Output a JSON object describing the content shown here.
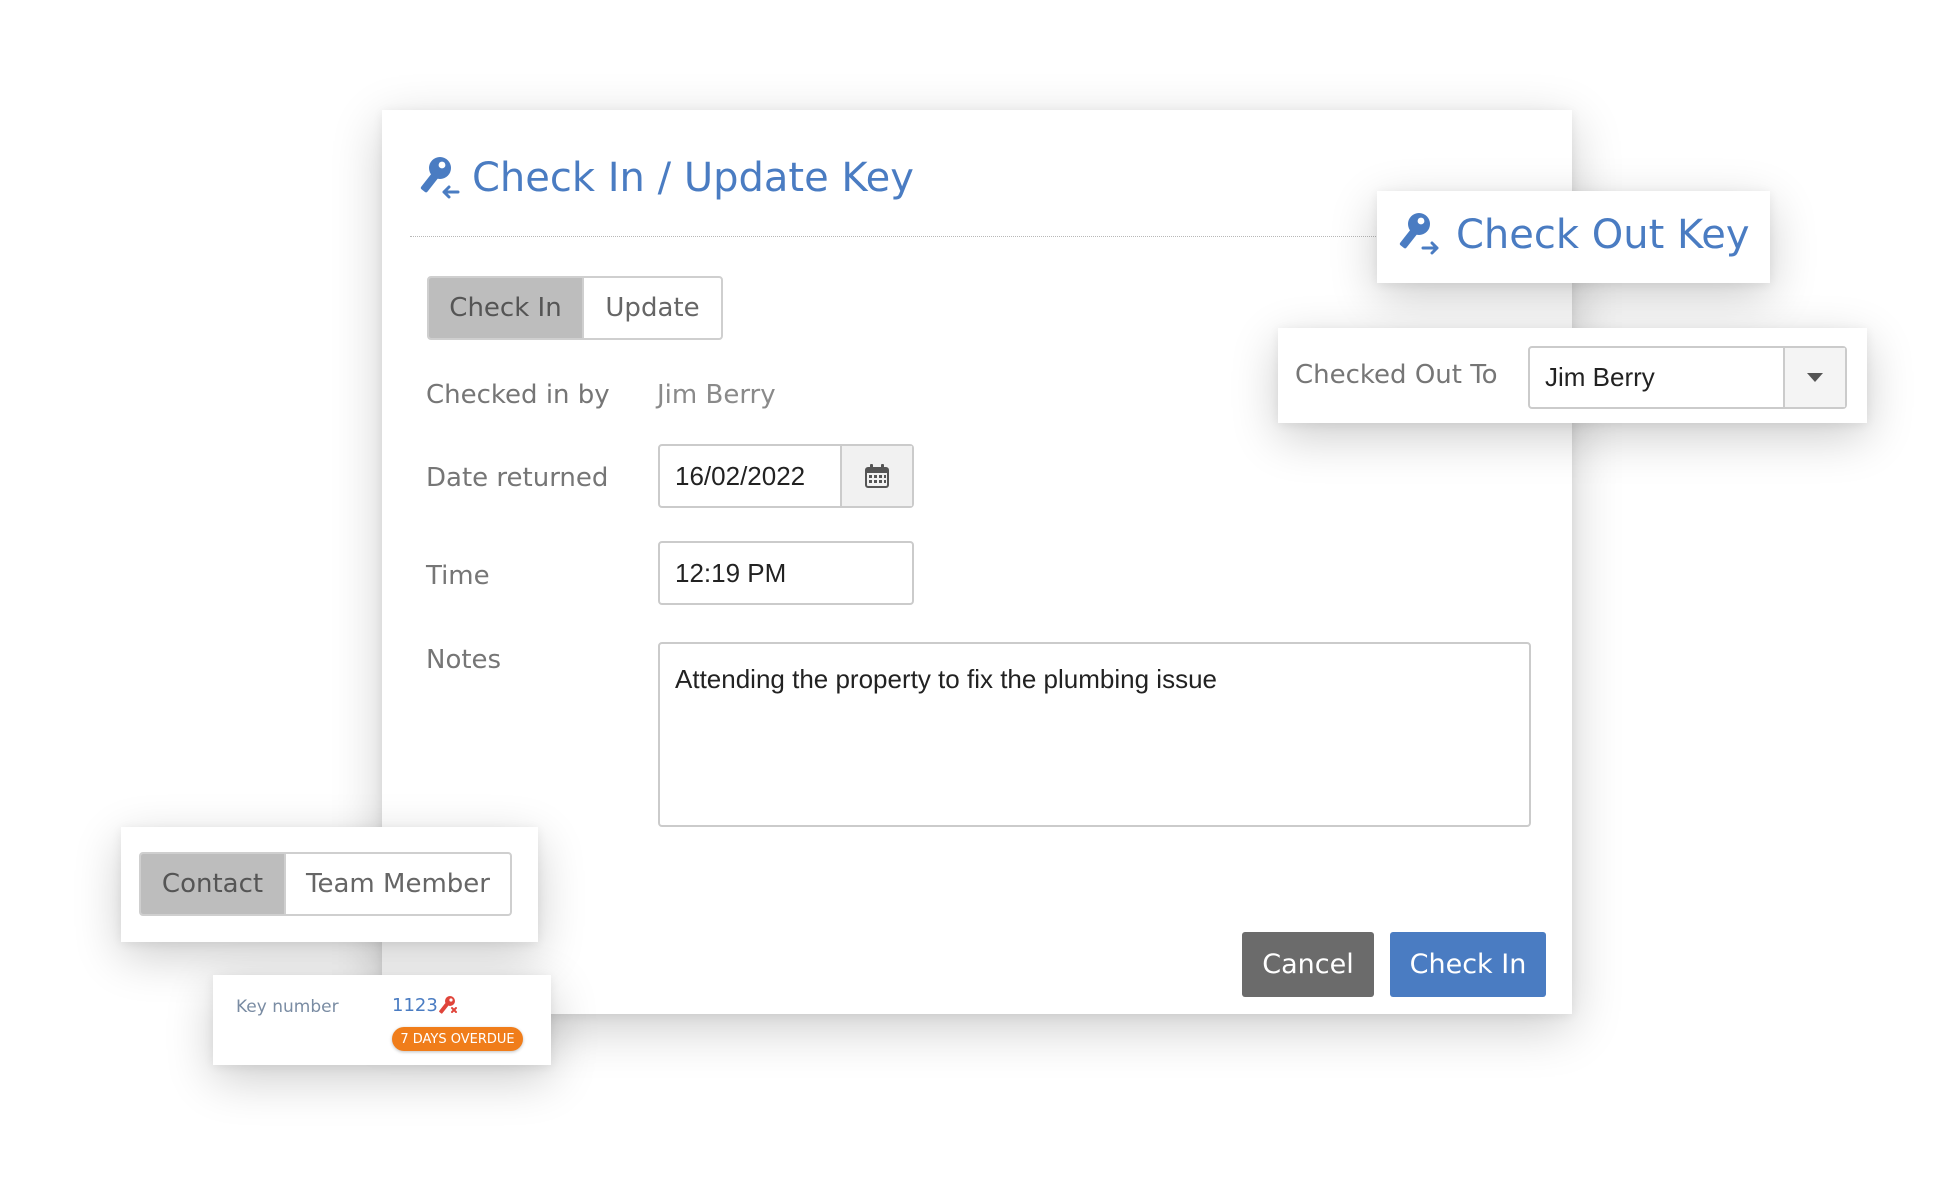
{
  "main_dialog": {
    "title": "Check In / Update Key",
    "mode_tabs": [
      "Check In",
      "Update"
    ],
    "active_mode": "Check In",
    "checked_in_by_label": "Checked in by",
    "checked_in_by_value": "Jim Berry",
    "date_returned_label": "Date returned",
    "date_returned_value": "16/02/2022",
    "time_label": "Time",
    "time_value": "12:19 PM",
    "notes_label": "Notes",
    "notes_value": "Attending the property to fix the plumbing issue",
    "cancel_label": "Cancel",
    "submit_label": "Check In"
  },
  "checkout_card": {
    "title": "Check Out Key"
  },
  "checked_out_card": {
    "label": "Checked Out To",
    "value": "Jim Berry"
  },
  "contact_card": {
    "tabs": [
      "Contact",
      "Team Member"
    ],
    "active": "Contact"
  },
  "key_card": {
    "label": "Key number",
    "number": "1123",
    "badge": "7 DAYS OVERDUE"
  },
  "colors": {
    "accent": "#4a7cc2",
    "primary_button": "#4a7cc2",
    "cancel_button": "#6b6b6b",
    "active_segment": "#bdbdbd",
    "overdue_badge": "#f07d1a",
    "key_alert_icon": "#e0443a"
  },
  "icons": [
    "key-checkin-icon",
    "key-checkout-icon",
    "calendar-icon",
    "caret-down-icon",
    "key-alert-icon"
  ]
}
